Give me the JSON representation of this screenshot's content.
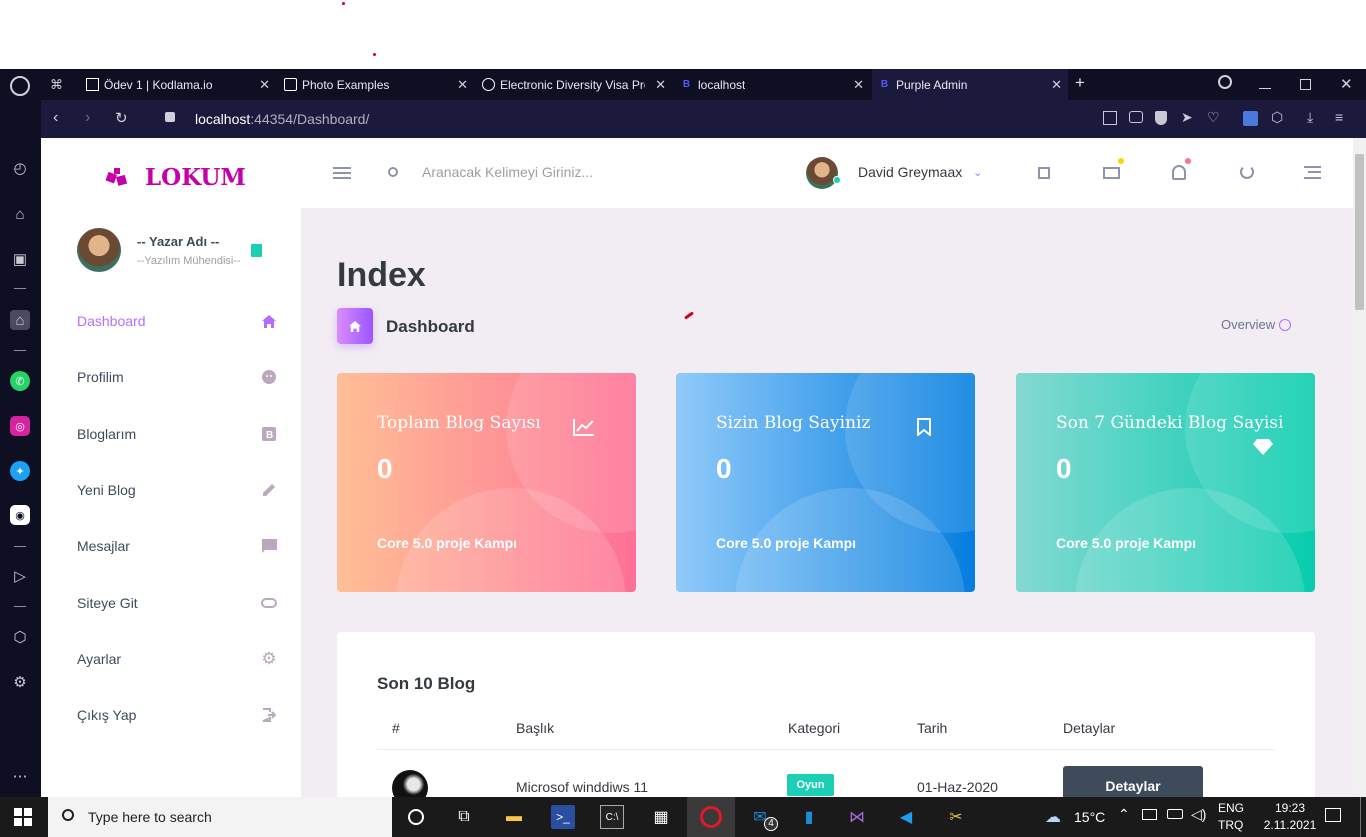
{
  "browser": {
    "tabs": [
      {
        "label": "Ödev 1 | Kodlama.io",
        "close": "✕"
      },
      {
        "label": "Photo Examples",
        "close": "✕"
      },
      {
        "label": "Electronic Diversity Visa Pro",
        "close": "✕"
      },
      {
        "label": "localhost",
        "close": "✕"
      },
      {
        "label": "Purple Admin",
        "close": "✕"
      }
    ],
    "new_tab": "+",
    "url_host": "localhost",
    "url_rest": ":44354/Dashboard/"
  },
  "brand": {
    "name": "LOKUM",
    "color": "#c400a8"
  },
  "user": {
    "name": "-- Yazar Adı --",
    "role": "--Yazılım Mühendisi--"
  },
  "sidebar": {
    "items": [
      {
        "label": "Dashboard",
        "icon": "home-icon"
      },
      {
        "label": "Profilim",
        "icon": "face-icon"
      },
      {
        "label": "Bloglarım",
        "icon": "blog-icon"
      },
      {
        "label": "Yeni Blog",
        "icon": "pencil-icon"
      },
      {
        "label": "Mesajlar",
        "icon": "message-icon"
      },
      {
        "label": "Siteye Git",
        "icon": "link-icon"
      },
      {
        "label": "Ayarlar",
        "icon": "gear-icon"
      },
      {
        "label": "Çıkış Yap",
        "icon": "logout-icon"
      }
    ]
  },
  "navbar": {
    "search_placeholder": "Aranacak Kelimeyi Giriniz...",
    "profile_name": "David Greymaax"
  },
  "main": {
    "page_title": "Index",
    "breadcrumb": "Dashboard",
    "overview": "Overview",
    "cards": [
      {
        "title": "Toplam Blog Sayısı",
        "value": "0",
        "footer": "Core 5.0 proje Kampı",
        "icon": "chart-line-icon",
        "colors": [
          "#ffbf96",
          "#fe7096"
        ]
      },
      {
        "title": "Sizin Blog Sayiniz",
        "value": "0",
        "footer": "Core 5.0 proje Kampı",
        "icon": "bookmark-icon",
        "colors": [
          "#90caf9",
          "#047edf"
        ]
      },
      {
        "title": "Son 7 Gündeki Blog Sayisi",
        "value": "0",
        "footer": "Core 5.0 proje Kampı",
        "icon": "diamond-icon",
        "colors": [
          "#84d9d2",
          "#07cdae"
        ]
      }
    ],
    "table": {
      "title": "Son 10 Blog",
      "headers": [
        "#",
        "Başlık",
        "Kategori",
        "Tarih",
        "Detaylar"
      ],
      "rows": [
        {
          "title": "Microsof winddiws 11",
          "category": "Oyun",
          "date": "01-Haz-2020",
          "button": "Detaylar"
        }
      ]
    }
  },
  "taskbar": {
    "search_placeholder": "Type here to search",
    "weather": "15°C",
    "lang_top": "ENG",
    "lang_bottom": "TRQ",
    "time": "19:23",
    "date": "2.11.2021",
    "mail_badge": "4"
  }
}
